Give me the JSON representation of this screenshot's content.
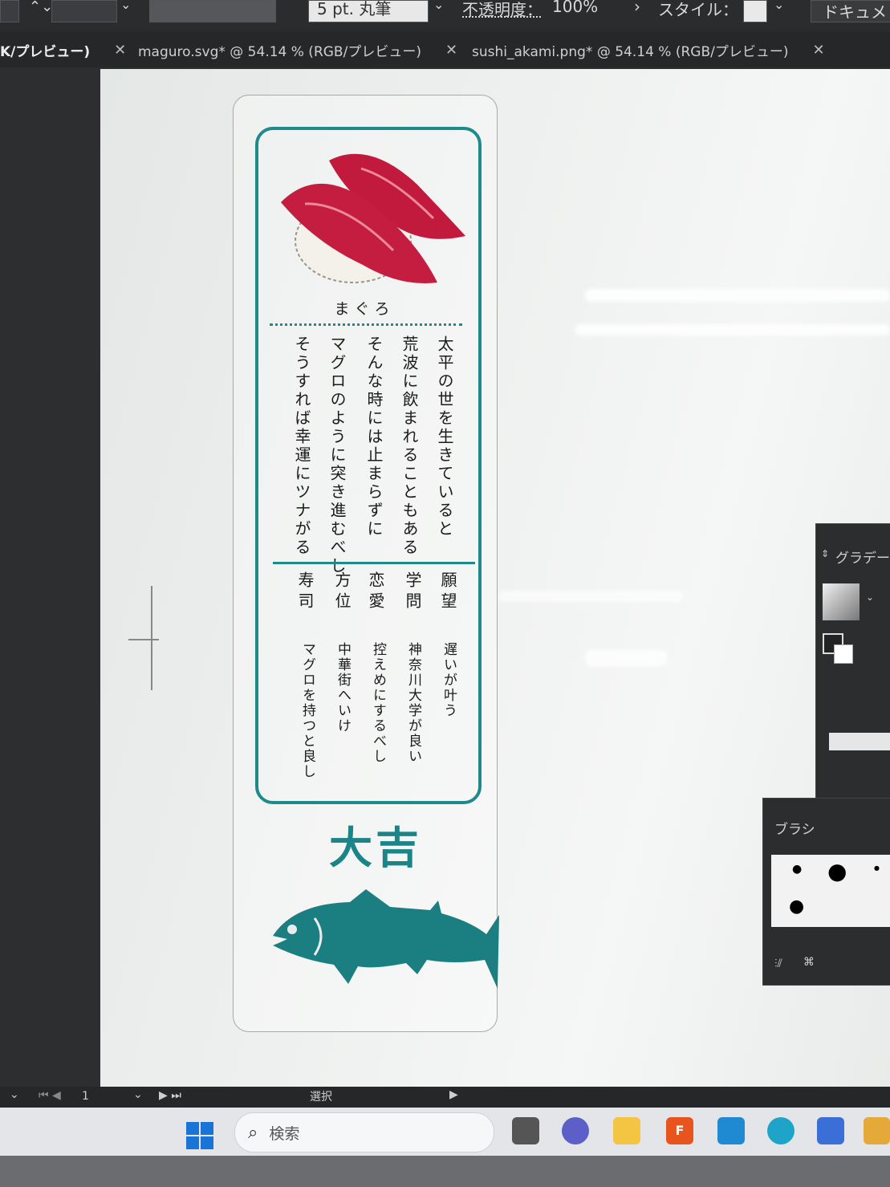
{
  "controlbar": {
    "stroke_profile": "5 pt. 丸筆",
    "opacity_label": "不透明度：",
    "opacity_value": "100%",
    "style_label": "スタイル：",
    "document_label": "ドキュメ"
  },
  "tabs": [
    {
      "label": "K/プレビュー)"
    },
    {
      "label": "maguro.svg* @ 54.14 % (RGB/プレビュー)"
    },
    {
      "label": "sushi_akami.png* @ 54.14 % (RGB/プレビュー)"
    }
  ],
  "omikuji": {
    "sushi_name": "まぐろ",
    "poem_lines": [
      "太平の世を生きていると",
      "荒波に飲まれることもある",
      "そんな時には止まらずに",
      "マグロのように突き進むべし",
      "そうすれば幸運にツナがる"
    ],
    "fortunes": [
      {
        "category": "願望",
        "answer": "遅いが叶う"
      },
      {
        "category": "学問",
        "answer": "神奈川大学が良い"
      },
      {
        "category": "恋愛",
        "answer": "控えめにするべし"
      },
      {
        "category": "方位",
        "answer": "中華街へいけ"
      },
      {
        "category": "寿司",
        "answer": "マグロを持つと良し"
      }
    ],
    "result": "大吉",
    "colors": {
      "teal": "#1e8a8c",
      "tuna_red": "#c21a3c"
    }
  },
  "panels": {
    "gradient_title": "グラデーシ",
    "brush_title": "ブラシ"
  },
  "statusbar": {
    "page_number": "1",
    "tool_name": "選択"
  },
  "taskbar": {
    "search_placeholder": "検索",
    "icons": [
      "windows-start-icon",
      "task-view-icon",
      "teams-meet-icon",
      "file-explorer-icon",
      "fresco-icon",
      "vscode-icon",
      "edge-icon",
      "store-icon",
      "paint-icon"
    ]
  }
}
